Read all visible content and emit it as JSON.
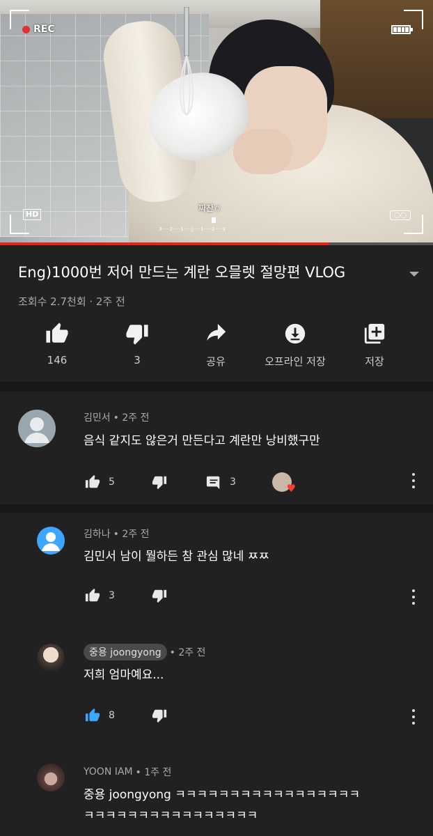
{
  "video": {
    "rec_label": "REC",
    "hd_label": "HD",
    "caption": "짜잔✩",
    "ruler": "3·····2·····1·····|·····1·····2·····3",
    "progress_fraction": 0.76
  },
  "info": {
    "title": "Eng)1000번 저어 만드는 계란 오믈렛 절망편 VLOG",
    "meta": "조회수 2.7천회 · 2주 전"
  },
  "actions": [
    {
      "label": "146",
      "icon": "thumbs-up-icon"
    },
    {
      "label": "3",
      "icon": "thumbs-down-icon"
    },
    {
      "label": "공유",
      "icon": "share-icon"
    },
    {
      "label": "오프라인 저장",
      "icon": "download-icon"
    },
    {
      "label": "저장",
      "icon": "add-to-playlist-icon"
    }
  ],
  "comments": [
    {
      "author": "김민서",
      "time": "• 2주 전",
      "text": "음식 같지도 않은거 만든다고 계란만 낭비했구만",
      "likes": "5",
      "replies": "3"
    },
    {
      "author": "김하나",
      "time": "• 2주 전",
      "text": "김민서 남이 뭘하든 참 관심 많네 ㅉㅉ",
      "likes": "3"
    },
    {
      "author": "중용 joongyong",
      "time": "• 2주 전",
      "text": "저희 엄마예요...",
      "likes": "8",
      "accent": "#3ea6ff"
    },
    {
      "author": "YOON IAM",
      "time": "• 1주 전",
      "text_line1": "중용 joongyong ㅋㅋㅋㅋㅋㅋㅋㅋㅋㅋㅋㅋㅋㅋㅋㅋㅋ",
      "text_line2": "ㅋㅋㅋㅋㅋㅋㅋㅋㅋㅋㅋㅋㅋㅋㅋㅋ"
    }
  ]
}
